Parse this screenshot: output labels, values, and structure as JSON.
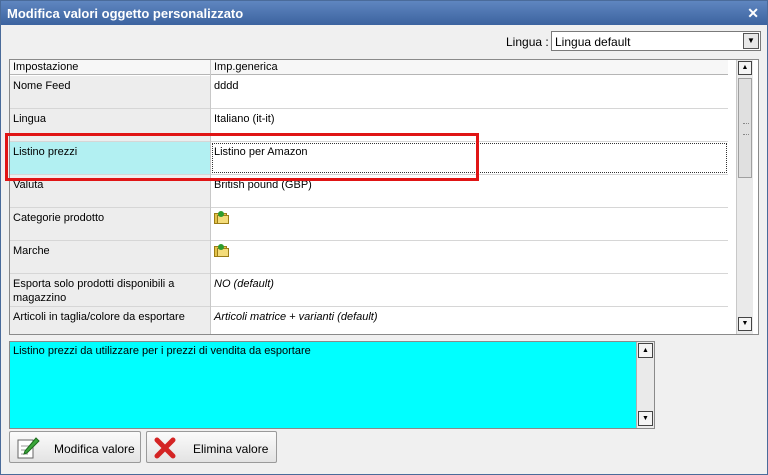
{
  "window": {
    "title": "Modifica valori oggetto personalizzato",
    "close": "✕"
  },
  "language": {
    "label": "Lingua :",
    "selected": "Lingua default"
  },
  "grid": {
    "headers": [
      "Impostazione",
      "Imp.generica"
    ],
    "rows": [
      {
        "label": "Nome Feed",
        "value": "dddd"
      },
      {
        "label": "Lingua",
        "value": "Italiano (it-it)"
      },
      {
        "label": "Listino prezzi",
        "value": "Listino per Amazon"
      },
      {
        "label": "Valuta",
        "value": "British pound (GBP)"
      },
      {
        "label": "Categorie prodotto",
        "icon": "folder-add-icon"
      },
      {
        "label": "Marche",
        "icon": "folder-add-icon"
      },
      {
        "label": "Esporta solo prodotti disponibili a magazzino",
        "value": "NO (default)"
      },
      {
        "label": "Articoli in taglia/colore da esportare",
        "value": "Articoli matrice + varianti (default)"
      }
    ]
  },
  "description": {
    "text": "Listino prezzi da utilizzare per i prezzi di vendita da esportare"
  },
  "buttons": {
    "edit": "Modifica valore",
    "delete": "Elimina valore"
  },
  "colors": {
    "highlight": "#e01515",
    "description_bg": "#00ffff",
    "selected_label_bg": "#b2f0f2"
  }
}
